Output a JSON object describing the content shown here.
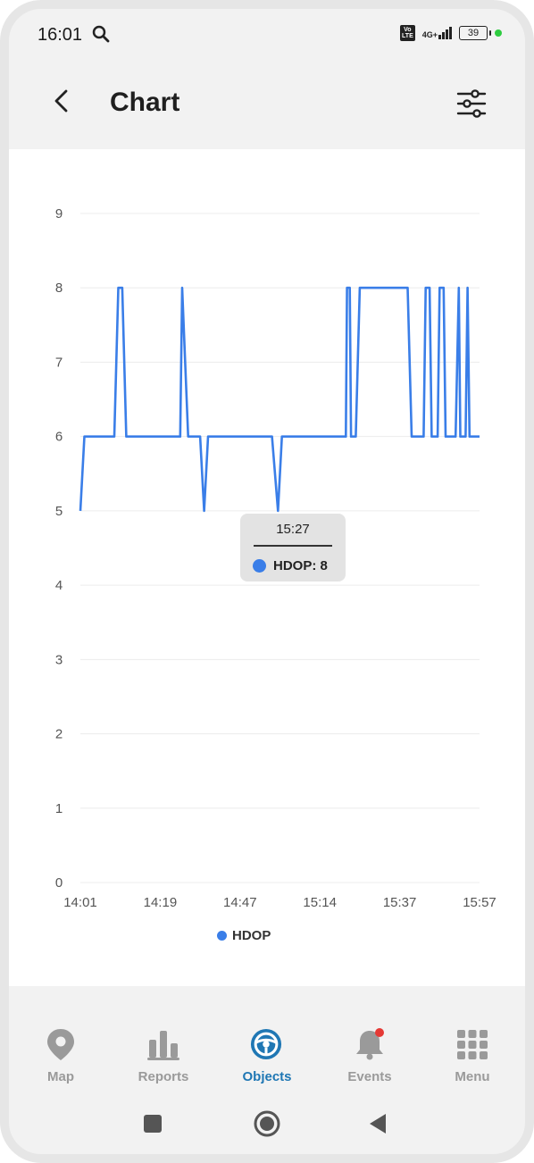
{
  "status_bar": {
    "time": "16:01",
    "volte_label": "Vo\nLTE",
    "network_label": "4G+",
    "battery_level": "39",
    "icons": [
      "search-icon",
      "volte-icon",
      "signal-icon",
      "battery-icon",
      "privacy-dot"
    ]
  },
  "header": {
    "title": "Chart",
    "back_icon": "chevron-left-icon",
    "filter_icon": "sliders-icon"
  },
  "chart_data": {
    "type": "line",
    "title": "",
    "xlabel": "",
    "ylabel": "",
    "ylim": [
      0,
      9
    ],
    "yticks": [
      "0",
      "1",
      "2",
      "3",
      "4",
      "5",
      "6",
      "7",
      "8",
      "9"
    ],
    "xticks": [
      "14:01",
      "14:19",
      "14:47",
      "15:14",
      "15:37",
      "15:57"
    ],
    "grid": true,
    "legend_position": "bottom-center",
    "series": [
      {
        "name": "HDOP",
        "color": "#3a7ee8",
        "points": [
          [
            0.0,
            5
          ],
          [
            0.01,
            6
          ],
          [
            0.085,
            6
          ],
          [
            0.095,
            8
          ],
          [
            0.105,
            8
          ],
          [
            0.115,
            6
          ],
          [
            0.25,
            6
          ],
          [
            0.255,
            8
          ],
          [
            0.27,
            6
          ],
          [
            0.3,
            6
          ],
          [
            0.31,
            5
          ],
          [
            0.32,
            6
          ],
          [
            0.48,
            6
          ],
          [
            0.495,
            5
          ],
          [
            0.505,
            6
          ],
          [
            0.665,
            6
          ],
          [
            0.668,
            8
          ],
          [
            0.675,
            8
          ],
          [
            0.678,
            6
          ],
          [
            0.69,
            6
          ],
          [
            0.7,
            8
          ],
          [
            0.82,
            8
          ],
          [
            0.83,
            6
          ],
          [
            0.86,
            6
          ],
          [
            0.865,
            8
          ],
          [
            0.875,
            8
          ],
          [
            0.88,
            6
          ],
          [
            0.895,
            6
          ],
          [
            0.9,
            8
          ],
          [
            0.91,
            8
          ],
          [
            0.915,
            6
          ],
          [
            0.94,
            6
          ],
          [
            0.948,
            8
          ],
          [
            0.952,
            6
          ],
          [
            0.965,
            6
          ],
          [
            0.97,
            8
          ],
          [
            0.975,
            6
          ],
          [
            1.0,
            6
          ]
        ]
      }
    ]
  },
  "tooltip": {
    "time": "15:27",
    "value_label": "HDOP: 8"
  },
  "legend": {
    "label": "HDOP"
  },
  "bottom_nav": {
    "active": "Objects",
    "active_color": "#1f77b4",
    "items": [
      {
        "label": "Map",
        "icon": "map-pin-icon"
      },
      {
        "label": "Reports",
        "icon": "bar-chart-icon"
      },
      {
        "label": "Objects",
        "icon": "steering-wheel-icon"
      },
      {
        "label": "Events",
        "icon": "bell-icon"
      },
      {
        "label": "Menu",
        "icon": "grid-icon"
      }
    ]
  },
  "system_nav": {
    "icons": [
      "recents-icon",
      "home-icon",
      "back-triangle-icon"
    ]
  }
}
